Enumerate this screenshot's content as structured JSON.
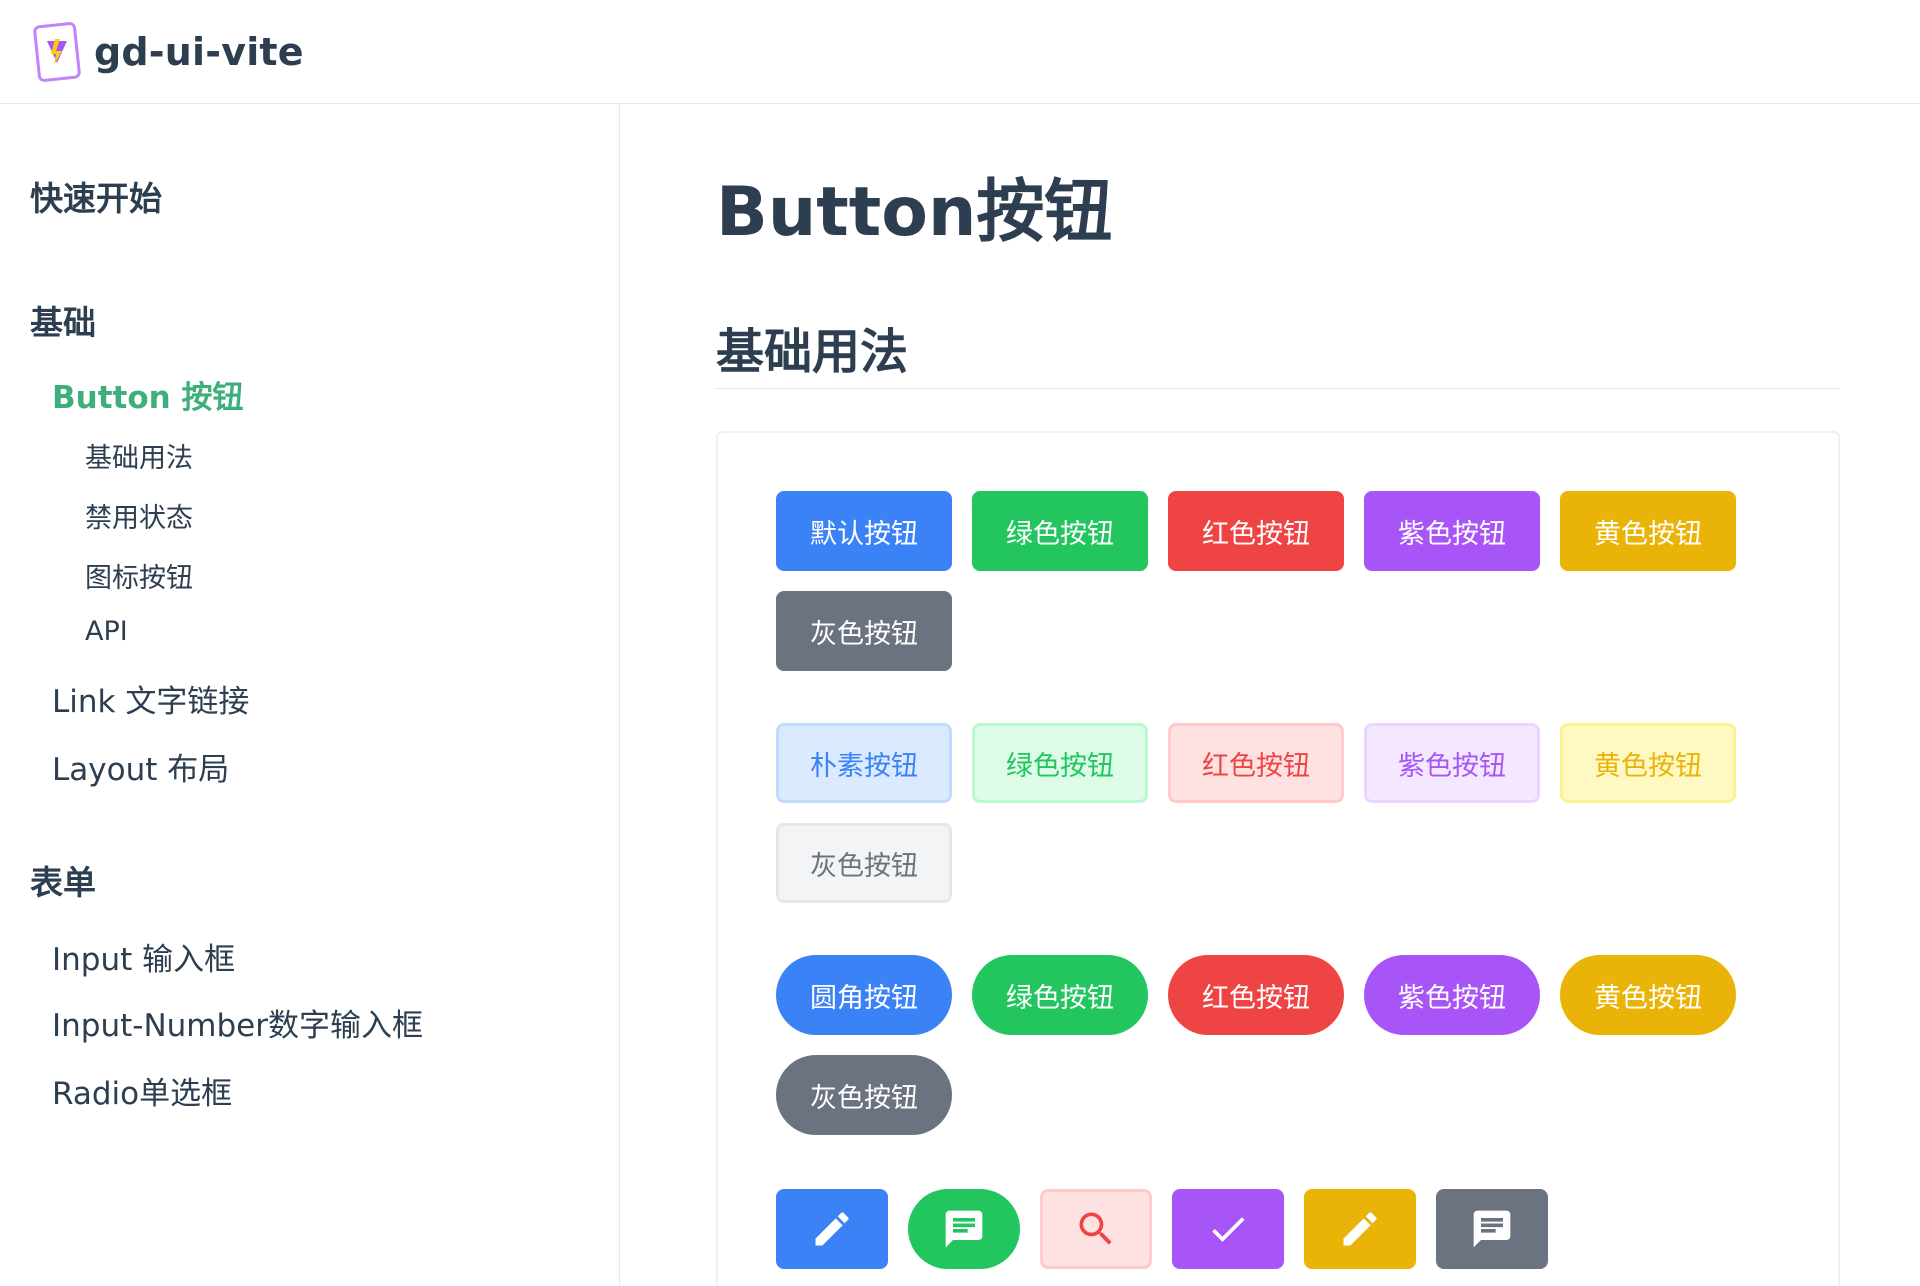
{
  "site": {
    "title": "gd-ui-vite",
    "logo_icon": "vite-logo-icon"
  },
  "sidebar": {
    "quickstart": "快速开始",
    "group_basic": "基础",
    "button_link": "Button 按钮",
    "sub_items": [
      "基础用法",
      "禁用状态",
      "图标按钮",
      "API"
    ],
    "link_link": "Link 文字链接",
    "layout_link": "Layout 布局",
    "group_form": "表单",
    "input_link": "Input 输入框",
    "input_number_link": "Input-Number数字输入框",
    "radio_link": "Radio单选框"
  },
  "main": {
    "page_title": "Button按钮",
    "section_title": "基础用法",
    "rows": [
      {
        "style": "solid",
        "buttons": [
          {
            "label": "默认按钮",
            "bg": "#3b82f6",
            "color": "#ffffff"
          },
          {
            "label": "绿色按钮",
            "bg": "#22c55e",
            "color": "#ffffff"
          },
          {
            "label": "红色按钮",
            "bg": "#ef4444",
            "color": "#ffffff"
          },
          {
            "label": "紫色按钮",
            "bg": "#a855f7",
            "color": "#ffffff"
          },
          {
            "label": "黄色按钮",
            "bg": "#eab308",
            "color": "#ffffff"
          },
          {
            "label": "灰色按钮",
            "bg": "#6b7280",
            "color": "#ffffff"
          }
        ]
      },
      {
        "style": "plain",
        "buttons": [
          {
            "label": "朴素按钮",
            "bg": "#dbeafe",
            "border": "#bfdbfe",
            "color": "#3b82f6"
          },
          {
            "label": "绿色按钮",
            "bg": "#dcfce7",
            "border": "#bbf7d0",
            "color": "#22c55e"
          },
          {
            "label": "红色按钮",
            "bg": "#fee2e2",
            "border": "#fecaca",
            "color": "#ef4444"
          },
          {
            "label": "紫色按钮",
            "bg": "#f3e8ff",
            "border": "#e9d5ff",
            "color": "#a855f7"
          },
          {
            "label": "黄色按钮",
            "bg": "#fef9c3",
            "border": "#fef08a",
            "color": "#eab308"
          },
          {
            "label": "灰色按钮",
            "bg": "#f3f4f6",
            "border": "#e5e7eb",
            "color": "#6b7280"
          }
        ]
      },
      {
        "style": "round",
        "buttons": [
          {
            "label": "圆角按钮",
            "bg": "#3b82f6",
            "color": "#ffffff"
          },
          {
            "label": "绿色按钮",
            "bg": "#22c55e",
            "color": "#ffffff"
          },
          {
            "label": "红色按钮",
            "bg": "#ef4444",
            "color": "#ffffff"
          },
          {
            "label": "紫色按钮",
            "bg": "#a855f7",
            "color": "#ffffff"
          },
          {
            "label": "黄色按钮",
            "bg": "#eab308",
            "color": "#ffffff"
          },
          {
            "label": "灰色按钮",
            "bg": "#6b7280",
            "color": "#ffffff"
          }
        ]
      }
    ],
    "icon_buttons": [
      {
        "icon": "pencil-icon",
        "bg": "#3b82f6",
        "color": "#ffffff",
        "shape": "square"
      },
      {
        "icon": "message-icon",
        "bg": "#22c55e",
        "color": "#ffffff",
        "shape": "round"
      },
      {
        "icon": "search-icon",
        "bg": "#fee2e2",
        "border": "#fecaca",
        "color": "#ef4444",
        "shape": "square"
      },
      {
        "icon": "check-icon",
        "bg": "#a855f7",
        "color": "#ffffff",
        "shape": "square"
      },
      {
        "icon": "pencil-icon",
        "bg": "#eab308",
        "color": "#ffffff",
        "shape": "square"
      },
      {
        "icon": "message-icon",
        "bg": "#6b7280",
        "color": "#ffffff",
        "shape": "square"
      }
    ]
  }
}
